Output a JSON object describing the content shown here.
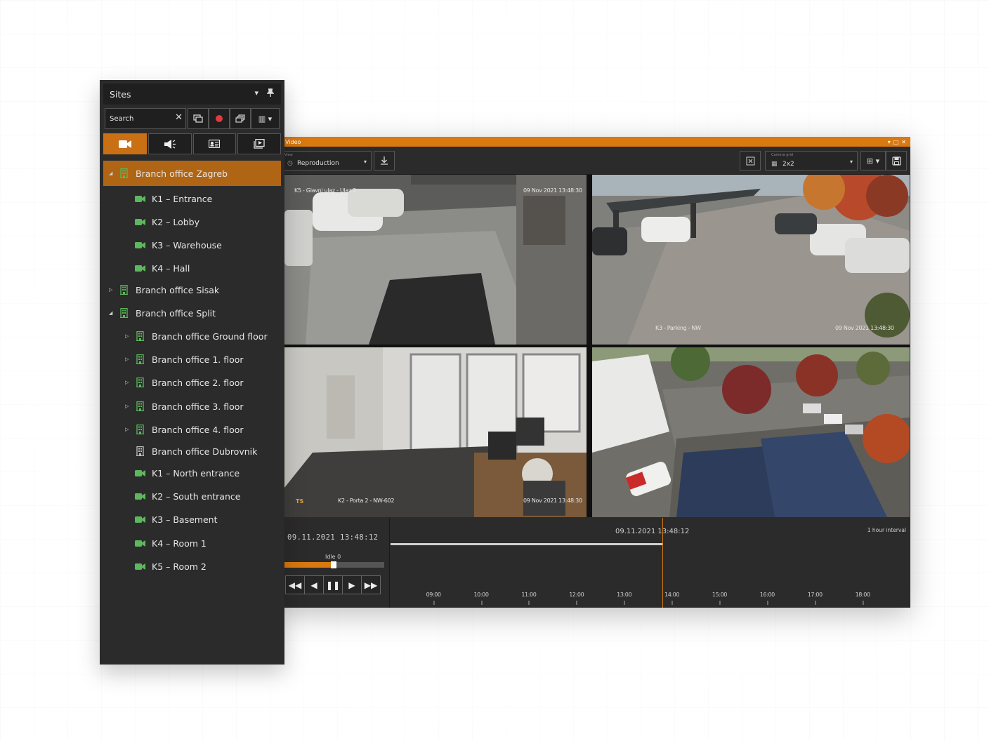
{
  "colors": {
    "accent": "#d9790f",
    "panel_bg": "#2b2b2b",
    "icon_green": "#5cb85c",
    "record_red": "#e03a3a"
  },
  "sites_panel": {
    "title": "Sites",
    "search": {
      "placeholder": "Search",
      "value": ""
    },
    "tabs": [
      {
        "icon": "video-camera-icon",
        "active": true
      },
      {
        "icon": "megaphone-icon",
        "active": false
      },
      {
        "icon": "id-card-icon",
        "active": false
      },
      {
        "icon": "playback-icon",
        "active": false
      }
    ],
    "tree": [
      {
        "label": "Branch office Zagreb",
        "type": "site",
        "state": "expanded",
        "selected": true,
        "level": 0
      },
      {
        "label": "K1 – Entrance",
        "type": "camera",
        "level": 1
      },
      {
        "label": "K2 – Lobby",
        "type": "camera",
        "level": 1
      },
      {
        "label": "K3 – Warehouse",
        "type": "camera",
        "level": 1
      },
      {
        "label": "K4 – Hall",
        "type": "camera",
        "level": 1
      },
      {
        "label": "Branch office Sisak",
        "type": "site",
        "state": "collapsed",
        "level": 0
      },
      {
        "label": "Branch office Split",
        "type": "site",
        "state": "expanded",
        "level": 0
      },
      {
        "label": "Branch office Ground floor",
        "type": "site",
        "state": "collapsed",
        "level": 1
      },
      {
        "label": "Branch office 1. floor",
        "type": "site",
        "state": "collapsed",
        "level": 1
      },
      {
        "label": "Branch office 2. floor",
        "type": "site",
        "state": "collapsed",
        "level": 1
      },
      {
        "label": "Branch office 3. floor",
        "type": "site",
        "state": "collapsed",
        "level": 1
      },
      {
        "label": "Branch office 4. floor",
        "type": "site",
        "state": "collapsed",
        "level": 1
      },
      {
        "label": "Branch office Dubrovnik",
        "type": "site-gray",
        "state": "none",
        "level": 1
      },
      {
        "label": "K1 – North entrance",
        "type": "camera",
        "level": 1
      },
      {
        "label": "K2 – South entrance",
        "type": "camera",
        "level": 1
      },
      {
        "label": "K3 – Basement",
        "type": "camera",
        "level": 1
      },
      {
        "label": "K4 – Room 1",
        "type": "camera",
        "level": 1
      },
      {
        "label": "K5 – Room 2",
        "type": "camera",
        "level": 1
      }
    ]
  },
  "video_window": {
    "title": "Video",
    "view": {
      "label": "View",
      "value": "Reproduction"
    },
    "camera_grid": {
      "label": "Camera grid",
      "value": "2x2"
    },
    "cameras": [
      {
        "overlay": "K5 - Glavni ulaz - Ulaz 2",
        "timestamp": "09 Nov 2021  13:48:30"
      },
      {
        "overlay": "K3 - Parking - NW",
        "timestamp": "09 Nov 2021  13:48:30"
      },
      {
        "overlay": "K2 - Porta 2 - NW-602",
        "timestamp": "09 Nov 2021  13:48:30"
      },
      {
        "overlay": "",
        "timestamp": ""
      }
    ],
    "timeline": {
      "current_time": "09.11.2021  13:48:12",
      "cursor_time": "09.11.2021 13:48:12",
      "speed_label": "Idle 0",
      "speed_fraction": 0.49,
      "interval_label": "1 hour interval",
      "hours": [
        "09:00",
        "10:00",
        "11:00",
        "12:00",
        "13:00",
        "14:00",
        "15:00",
        "16:00",
        "17:00",
        "18:00"
      ],
      "cursor_hour": 13.8,
      "start_hour": 8.1,
      "end_hour": 19.0
    }
  }
}
